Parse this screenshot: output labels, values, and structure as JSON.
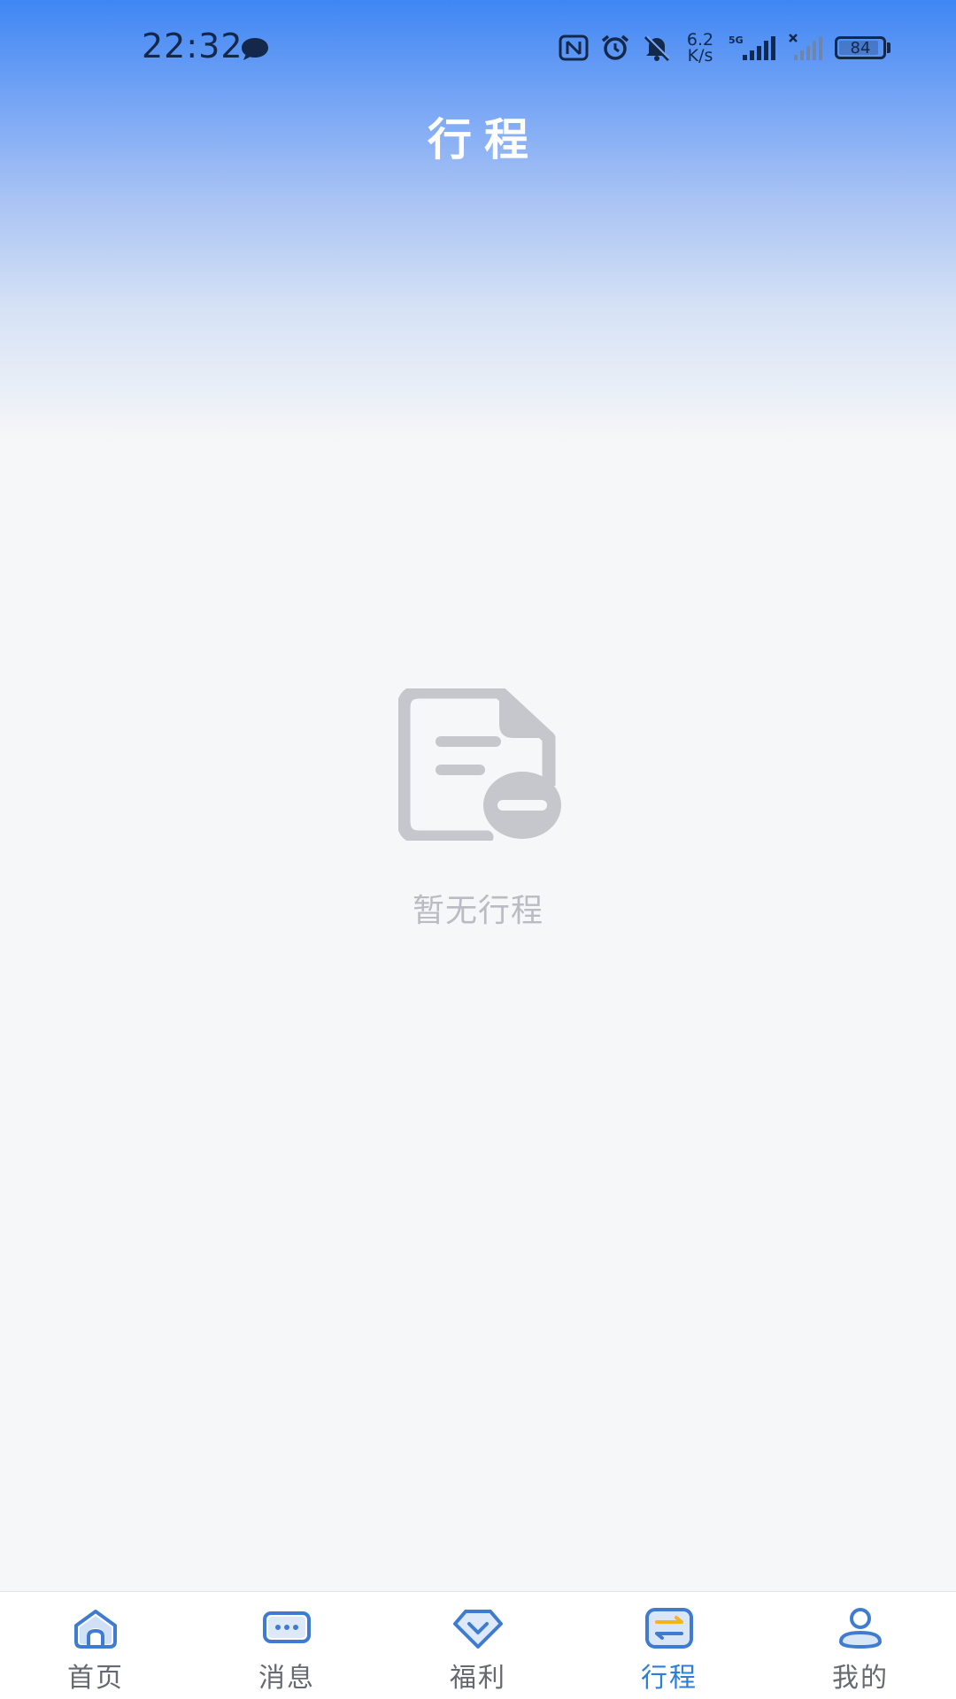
{
  "status_bar": {
    "time": "22:32",
    "net_speed_top": "6.2",
    "net_speed_bottom": "K/s",
    "signal_tag": "5G",
    "battery_level": "84",
    "battery_fraction": 0.84,
    "icons": [
      "message-bubble-icon",
      "nfc-icon",
      "alarm-icon",
      "bell-off-icon",
      "signal-5g-icon",
      "signal-no-service-icon",
      "battery-icon"
    ]
  },
  "header": {
    "title": "行程"
  },
  "empty_state": {
    "icon": "document-minus-icon",
    "text": "暂无行程"
  },
  "bottom_nav": {
    "active_index": 3,
    "active_color": "#2b7fd9",
    "inactive_color": "#666a70",
    "items": [
      {
        "label": "首页",
        "icon": "home-icon"
      },
      {
        "label": "消息",
        "icon": "message-icon"
      },
      {
        "label": "福利",
        "icon": "benefit-icon"
      },
      {
        "label": "行程",
        "icon": "trip-icon"
      },
      {
        "label": "我的",
        "icon": "profile-icon"
      }
    ]
  }
}
